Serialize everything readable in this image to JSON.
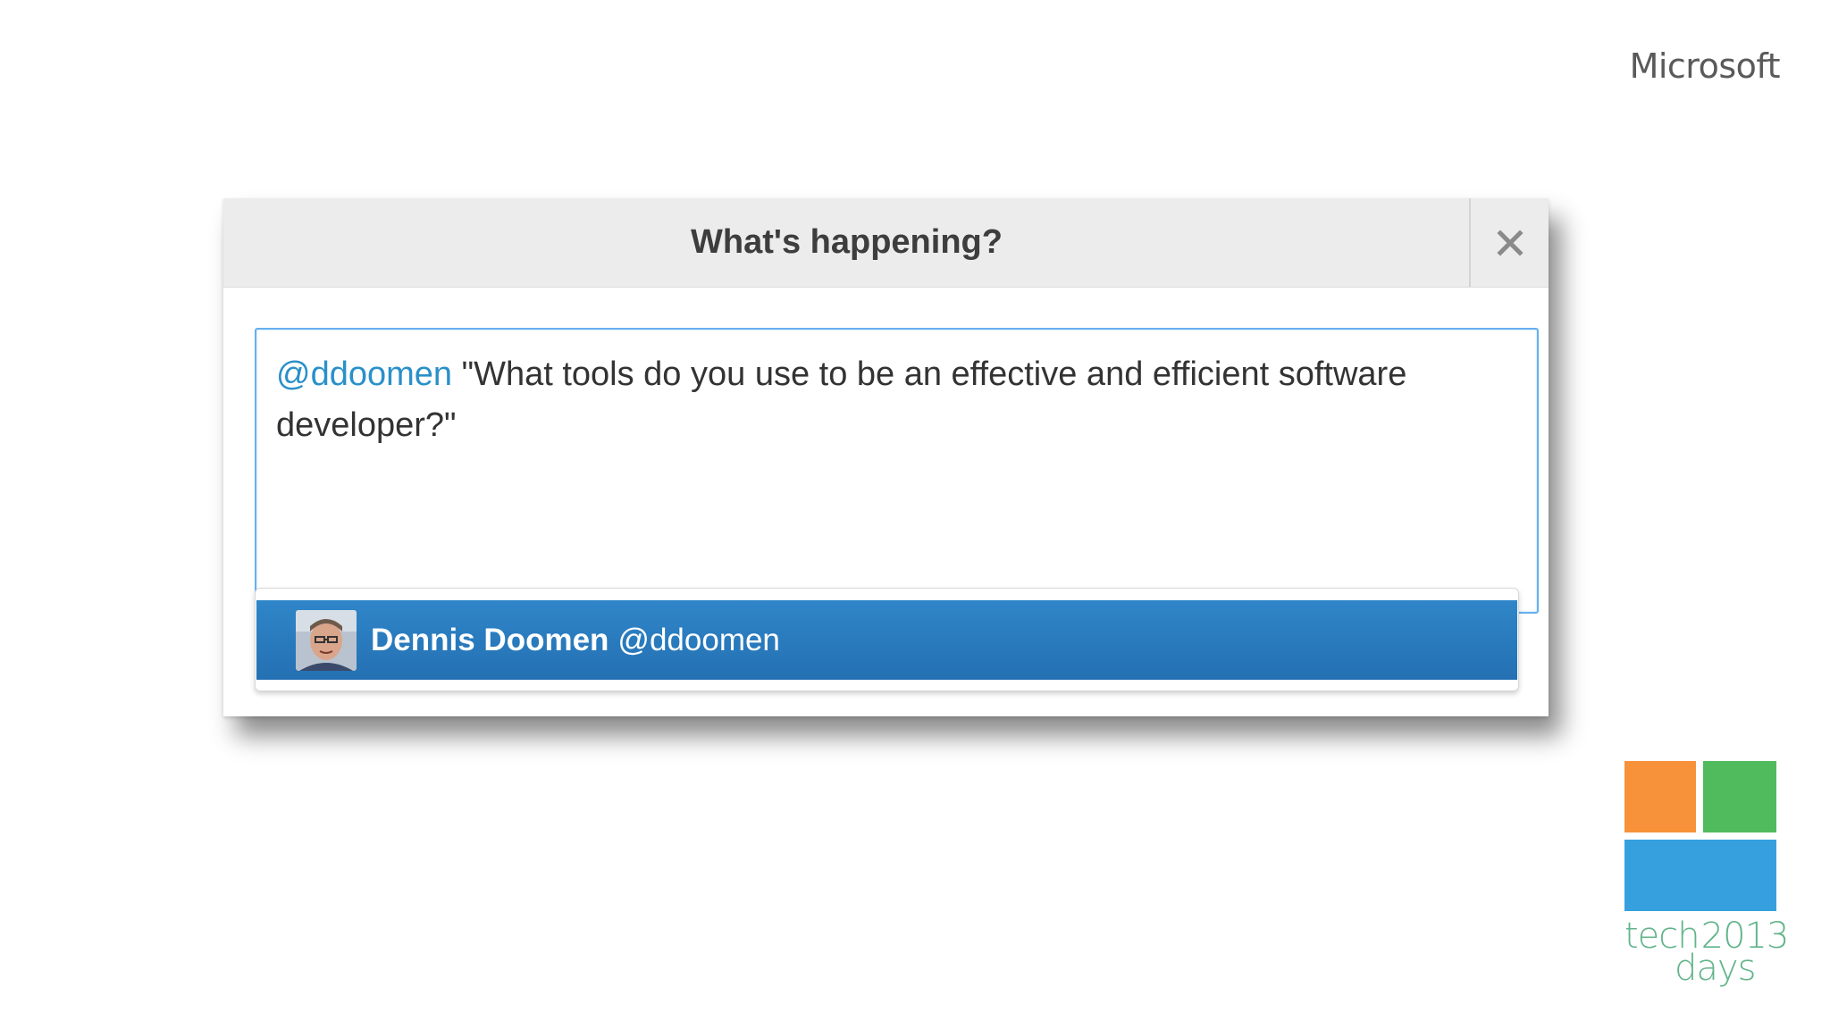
{
  "brand": {
    "name": "Microsoft"
  },
  "dialog": {
    "title": "What's happening?",
    "close_icon": "close-icon"
  },
  "tweet": {
    "mention": "@ddoomen",
    "text": " \"What tools do you use to be an effective and efficient software developer?\""
  },
  "suggestions": [
    {
      "name": "Dennis Doomen",
      "handle": "@ddoomen",
      "avatar_icon": "avatar-photo",
      "selected": true
    }
  ],
  "event_logo": {
    "word1": "tech",
    "year": "2013",
    "word2": "days",
    "colors": {
      "orange": "#f7923a",
      "green": "#4fbb5c",
      "blue": "#36a0df",
      "text": "#62b48a"
    }
  },
  "colors": {
    "mention": "#2a90c9",
    "selection": "#2470b3",
    "input_border": "#66aff0",
    "header_bg": "#ececec"
  }
}
